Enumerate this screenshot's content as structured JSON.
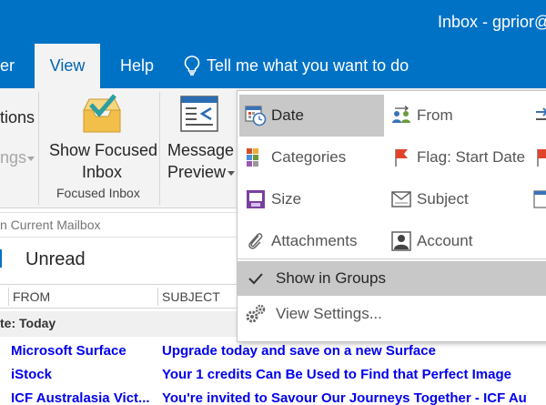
{
  "window": {
    "title": "Inbox - gprior@"
  },
  "tabs": [
    {
      "label": "er"
    },
    {
      "label": "View"
    },
    {
      "label": "Help"
    }
  ],
  "tell_me": {
    "label": "Tell me what you want to do"
  },
  "ribbon": {
    "partial_left_1": "tions",
    "partial_left_2": "ngs",
    "show_focused_inbox": {
      "line1": "Show Focused",
      "line2": "Inbox"
    },
    "group_label": "Focused Inbox",
    "message_preview": {
      "line1": "Message",
      "line2": "Preview"
    }
  },
  "search": {
    "text": "n Current Mailbox"
  },
  "filter": {
    "unread": "Unread"
  },
  "columns": {
    "from": "FROM",
    "subject": "SUBJECT"
  },
  "group_header": "te: Today",
  "messages": [
    {
      "from": "Microsoft Surface",
      "subject": "Upgrade today and save on a new Surface"
    },
    {
      "from": "iStock",
      "subject": "Your 1 credits Can Be Used to Find that Perfect Image"
    },
    {
      "from": "ICF Australasia Vict...",
      "subject": "You're invited to Savour Our Journeys Together - ICF Au"
    }
  ],
  "arrange_menu": {
    "items": [
      {
        "label": "Date",
        "selected": true,
        "icon": "calendar-clock-icon"
      },
      {
        "label": "From",
        "selected": false,
        "icon": "people-arrows-icon"
      },
      {
        "label": "Categories",
        "selected": false,
        "icon": "categories-grid-icon"
      },
      {
        "label": "Flag: Start Date",
        "selected": false,
        "icon": "flag-icon"
      },
      {
        "label": "Size",
        "selected": false,
        "icon": "size-icon"
      },
      {
        "label": "Subject",
        "selected": false,
        "icon": "envelope-icon"
      },
      {
        "label": "Attachments",
        "selected": false,
        "icon": "paperclip-icon"
      },
      {
        "label": "Account",
        "selected": false,
        "icon": "account-icon"
      }
    ],
    "show_in_groups": "Show in Groups",
    "view_settings": "View Settings..."
  },
  "colors": {
    "accent": "#0072c6",
    "link": "#0000ee",
    "flag": "#e0452b"
  }
}
